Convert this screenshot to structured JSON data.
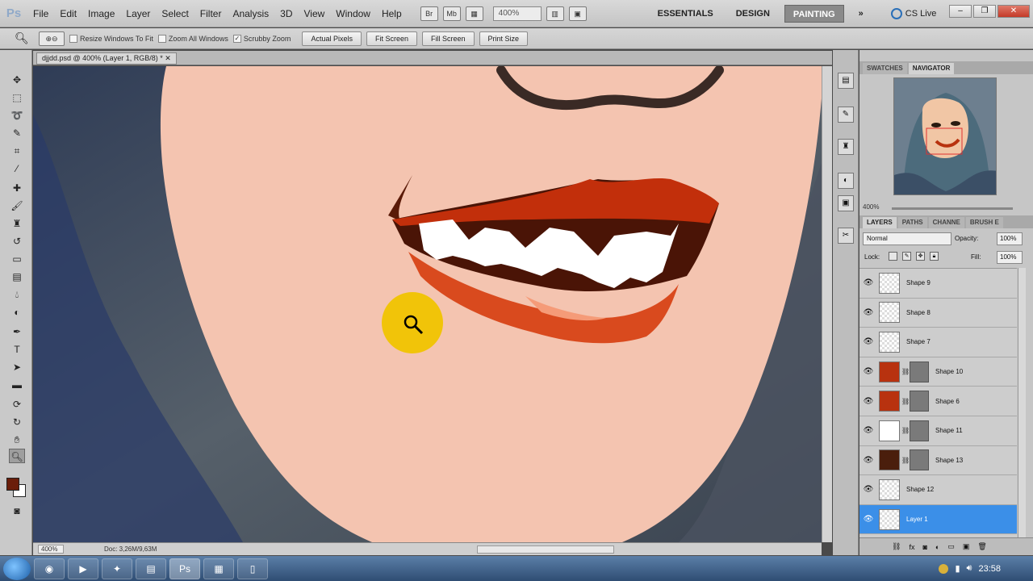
{
  "app": {
    "logo": "Ps"
  },
  "menu": [
    "File",
    "Edit",
    "Image",
    "Layer",
    "Select",
    "Filter",
    "Analysis",
    "3D",
    "View",
    "Window",
    "Help"
  ],
  "toolbar": {
    "zoom_level": "400%"
  },
  "workspaces": [
    {
      "label": "ESSENTIALS",
      "active": false
    },
    {
      "label": "DESIGN",
      "active": false
    },
    {
      "label": "PAINTING",
      "active": true
    }
  ],
  "cslive": "CS Live",
  "options": {
    "resize_windows": "Resize Windows To Fit",
    "zoom_all": "Zoom All Windows",
    "scrubby": "Scrubby Zoom",
    "scrubby_checked": "✓",
    "actual_pixels": "Actual Pixels",
    "fit_screen": "Fit Screen",
    "fill_screen": "Fill Screen",
    "print_size": "Print Size"
  },
  "document": {
    "tab_title": "djjdd.psd @ 400% (Layer 1, RGB/8) *",
    "status_zoom": "400%",
    "status_doc": "Doc: 3,26M/9,63M"
  },
  "panels": {
    "top_tabs": [
      "SWATCHES",
      "NAVIGATOR"
    ],
    "nav_zoom": "400%",
    "layer_tabs": [
      "LAYERS",
      "PATHS",
      "CHANNE",
      "BRUSH E"
    ],
    "blend_mode": "Normal",
    "opacity_label": "Opacity:",
    "opacity_value": "100%",
    "lock_label": "Lock:",
    "fill_label": "Fill:",
    "fill_value": "100%"
  },
  "layers": [
    {
      "name": "Shape 9",
      "thumb": "",
      "mask": false,
      "selected": false
    },
    {
      "name": "Shape 8",
      "thumb": "",
      "mask": false,
      "selected": false
    },
    {
      "name": "Shape 7",
      "thumb": "",
      "mask": false,
      "selected": false
    },
    {
      "name": "Shape 10",
      "thumb": "#b8320f",
      "mask": true,
      "selected": false
    },
    {
      "name": "Shape 6",
      "thumb": "#b8320f",
      "mask": true,
      "selected": false
    },
    {
      "name": "Shape 11",
      "thumb": "#ffffff",
      "mask": true,
      "selected": false
    },
    {
      "name": "Shape 13",
      "thumb": "#4a1e0c",
      "mask": true,
      "selected": false
    },
    {
      "name": "Shape 12",
      "thumb": "",
      "mask": false,
      "selected": false
    },
    {
      "name": "Layer 1",
      "thumb": "",
      "mask": false,
      "selected": true
    }
  ],
  "taskbar": {
    "clock": "23:58"
  },
  "colors": {
    "foreground": "#6b1e0a",
    "background": "#ffffff",
    "skin": "#f4c4b0",
    "lip": "#c22f0b",
    "selection": "#3b8fe8"
  }
}
